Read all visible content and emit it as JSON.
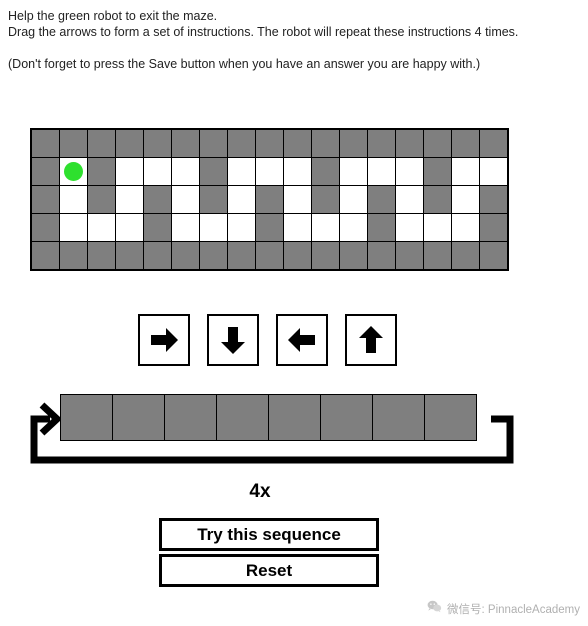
{
  "instructions": {
    "line1": "Help the green robot to exit the maze.",
    "line2": "Drag the arrows to form a set of instructions. The robot will repeat these instructions 4 times.",
    "line3": "(Don't forget to press the Save button when you have an answer you are happy with.)"
  },
  "maze": {
    "columns": 17,
    "rows": 5,
    "wall_color": "#7f7f7f",
    "path_color": "#ffffff",
    "robot_color": "#2ee02e",
    "robot_position": {
      "row": 1,
      "col": 1
    },
    "grid": [
      [
        "wall",
        "wall",
        "wall",
        "wall",
        "wall",
        "wall",
        "wall",
        "wall",
        "wall",
        "wall",
        "wall",
        "wall",
        "wall",
        "wall",
        "wall",
        "wall",
        "wall"
      ],
      [
        "wall",
        "path",
        "wall",
        "path",
        "path",
        "path",
        "wall",
        "path",
        "path",
        "path",
        "wall",
        "path",
        "path",
        "path",
        "wall",
        "path",
        "path"
      ],
      [
        "wall",
        "path",
        "wall",
        "path",
        "wall",
        "path",
        "wall",
        "path",
        "wall",
        "path",
        "wall",
        "path",
        "wall",
        "path",
        "wall",
        "path",
        "wall"
      ],
      [
        "wall",
        "path",
        "path",
        "path",
        "wall",
        "path",
        "path",
        "path",
        "wall",
        "path",
        "path",
        "path",
        "wall",
        "path",
        "path",
        "path",
        "wall"
      ],
      [
        "wall",
        "wall",
        "wall",
        "wall",
        "wall",
        "wall",
        "wall",
        "wall",
        "wall",
        "wall",
        "wall",
        "wall",
        "wall",
        "wall",
        "wall",
        "wall",
        "wall"
      ]
    ]
  },
  "arrow_palette": {
    "arrows": [
      {
        "name": "arrow-right",
        "label": "Right"
      },
      {
        "name": "arrow-down",
        "label": "Down"
      },
      {
        "name": "arrow-left",
        "label": "Left"
      },
      {
        "name": "arrow-up",
        "label": "Up"
      }
    ]
  },
  "sequence": {
    "slot_count": 8,
    "slots": [
      "",
      "",
      "",
      "",
      "",
      "",
      "",
      ""
    ],
    "slot_color": "#7f7f7f",
    "loop_label": "4x",
    "repeat_count": 4
  },
  "buttons": {
    "try": "Try this sequence",
    "reset": "Reset"
  },
  "watermark": {
    "icon": "wechat-icon",
    "text": "微信号: PinnacleAcademy"
  }
}
